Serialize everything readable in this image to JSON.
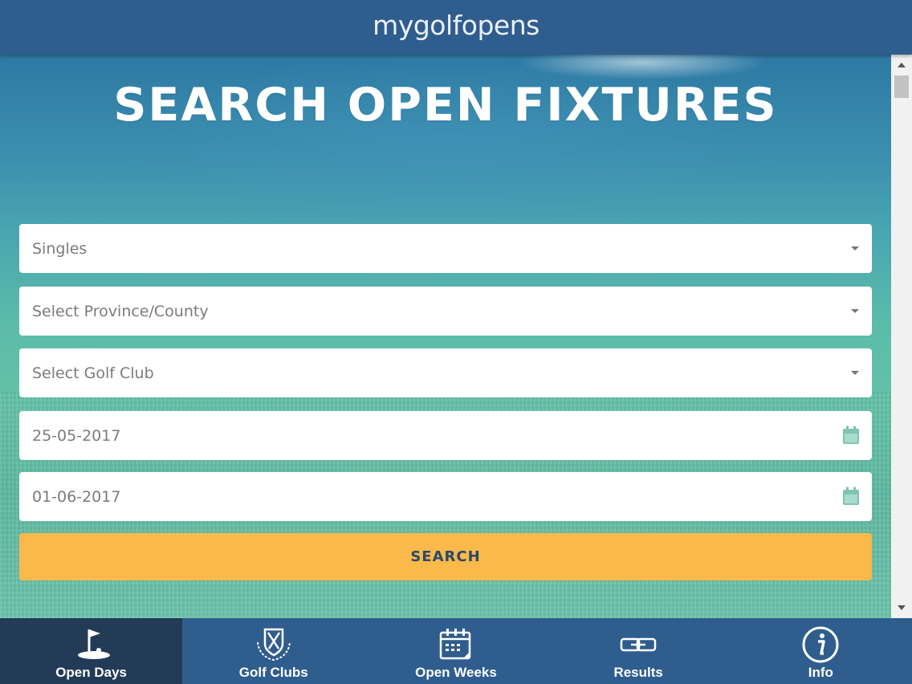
{
  "header": {
    "brand": "mygolfopens"
  },
  "hero": {
    "title": "SEARCH OPEN FIXTURES"
  },
  "form": {
    "type_select": {
      "value": "Singles"
    },
    "province_select": {
      "value": "Select Province/County"
    },
    "club_select": {
      "value": "Select Golf Club"
    },
    "date_from": {
      "value": "25-05-2017"
    },
    "date_to": {
      "value": "01-06-2017"
    },
    "search_label": "SEARCH"
  },
  "nav": {
    "items": [
      {
        "label": "Open Days",
        "icon": "flag-icon",
        "active": true
      },
      {
        "label": "Golf Clubs",
        "icon": "club-crest-icon",
        "active": false
      },
      {
        "label": "Open Weeks",
        "icon": "calendar-icon",
        "active": false
      },
      {
        "label": "Results",
        "icon": "link-icon",
        "active": false
      },
      {
        "label": "Info",
        "icon": "info-icon",
        "active": false
      }
    ]
  },
  "colors": {
    "header": "#2f5d8d",
    "nav_active": "#233b56",
    "accent_button": "#fbb84b",
    "button_text": "#2a4a6a",
    "calendar_icon": "#7ec4b2"
  }
}
